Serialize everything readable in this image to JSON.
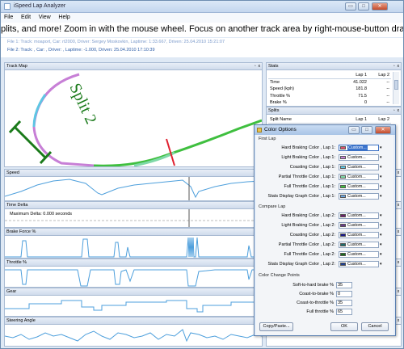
{
  "window": {
    "title": "iSpeed Lap Analyzer",
    "buttons": {
      "minimize": "▭",
      "maximize": "□",
      "close": "✕"
    }
  },
  "menu": {
    "file": "File",
    "edit": "Edit",
    "view": "View",
    "help": "Help"
  },
  "marquee": "plits, and more!  Zoom in with the mouse wheel. Focus on another track area by right-mouse-button dragging the track map.  Highli",
  "files": {
    "file1": "File 1: Track: moaport, Car: rt2000, Driver: Sergey Moskovkin, Laptime: 1:33.667, Driven: 25.04.2010 15:21:07",
    "file2": "File 2: Track: , Car: , Driver: , Laptime: -1.000, Driven: 25.04.2010 17:10:39"
  },
  "panels": {
    "track_map": "Track Map",
    "speed": "Speed",
    "time_delta": "Time Delta",
    "time_delta_note": "Maximum Delta: 0.000 seconds",
    "brake_force": "Brake Force %",
    "throttle": "Throttle %",
    "gear": "Gear",
    "steering": "Steering Angle",
    "split_label": "Split 2"
  },
  "stats": {
    "title": "Stats",
    "columns": [
      "",
      "Lap 1",
      "Lap 2"
    ],
    "rows": [
      [
        "Time",
        "41.022",
        "--"
      ],
      [
        "Speed (kph)",
        "181.8",
        "--"
      ],
      [
        "Throttle %",
        "71.5",
        "--"
      ],
      [
        "Brake %",
        "0",
        "--"
      ]
    ]
  },
  "splits": {
    "title": "Splits",
    "columns": [
      "Split Name",
      "Lap 1",
      "Lap 2"
    ]
  },
  "dialog": {
    "title": "Color Options",
    "first_lap": "First Lap",
    "compare_lap": "Compare Lap",
    "change_points": "Color Change Points",
    "first_rows": [
      {
        "label": "Hard Braking Color , Lap 1:",
        "value": "Custom...",
        "color": "#e0506e"
      },
      {
        "label": "Light Braking Color , Lap 1:",
        "value": "Custom...",
        "color": "#c77fd6"
      },
      {
        "label": "Coasting Color , Lap 1:",
        "value": "Custom...",
        "color": "#5ec6e3"
      },
      {
        "label": "Partial Throttle Color , Lap 1:",
        "value": "Custom...",
        "color": "#7fd9a8"
      },
      {
        "label": "Full Throttle Color , Lap 1:",
        "value": "Custom...",
        "color": "#3fbf3f"
      },
      {
        "label": "Stats Display Graph Color , Lap 1:",
        "value": "Custom...",
        "color": "#6fa7e0"
      }
    ],
    "compare_rows": [
      {
        "label": "Hard Braking Color , Lap 2:",
        "value": "Custom...",
        "color": "#6b1f6b"
      },
      {
        "label": "Light Braking Color , Lap 2:",
        "value": "Custom...",
        "color": "#6a3a8a"
      },
      {
        "label": "Coasting Color , Lap 2:",
        "value": "Custom...",
        "color": "#1b1b8a"
      },
      {
        "label": "Partial Throttle Color , Lap 2:",
        "value": "Custom...",
        "color": "#1f6b6b"
      },
      {
        "label": "Full Throttle Color , Lap 2:",
        "value": "Custom...",
        "color": "#1a6b1a"
      },
      {
        "label": "Stats Display Graph Color , Lap 2:",
        "value": "Custom...",
        "color": "#1f3f8f"
      }
    ],
    "points": [
      {
        "label": "Soft-to-hard brake %",
        "value": "35"
      },
      {
        "label": "Coast-to-brake %",
        "value": "0"
      },
      {
        "label": "Coast-to-throttle %",
        "value": "35"
      },
      {
        "label": "Full throttle %",
        "value": "65"
      }
    ],
    "buttons": {
      "copy_paste": "Copy/Paste...",
      "ok": "OK",
      "cancel": "Cancel"
    },
    "dropdown_glyph": "▾"
  }
}
